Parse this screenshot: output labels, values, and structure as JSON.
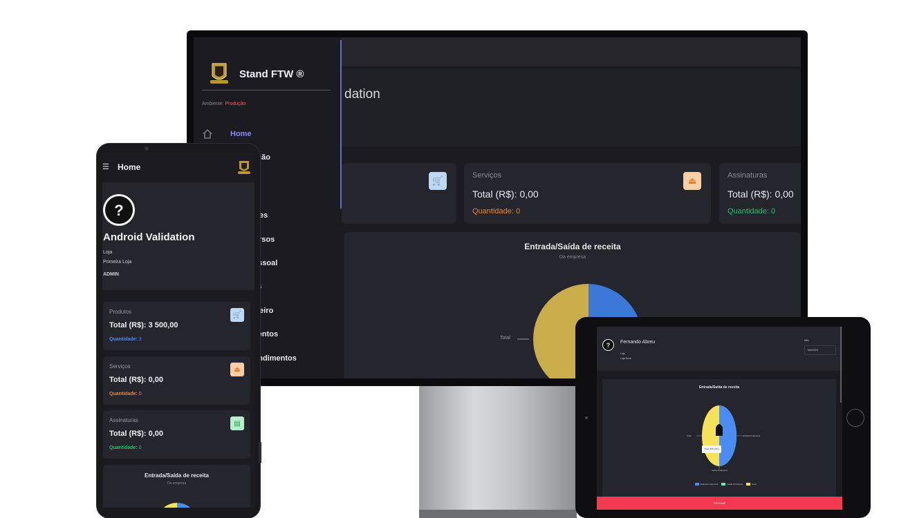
{
  "desktop": {
    "brand": "Stand FTW ®",
    "env_label": "Ambiente:",
    "env_value": "Produção",
    "page_title": "dation",
    "nav": [
      "Home",
      "tração",
      "ações",
      "rsos",
      "essoal",
      "es",
      "ceiro",
      "mentos",
      "eendimentos"
    ],
    "cards": [
      {
        "label": "Serviços",
        "total": "Total (R$): 0,00",
        "qty_label": "Quantidade:",
        "qty": "0"
      },
      {
        "label": "Assinaturas",
        "total": "Total (R$): 0,00",
        "qty_label": "Quantidade:",
        "qty": "0"
      }
    ],
    "chart": {
      "title": "Entrada/Saída de receita",
      "subtitle": "Da empresa",
      "pie_label": "Total"
    }
  },
  "phone": {
    "app_title": "Home",
    "name": "Android Validation",
    "store_label": "Loja",
    "store_value": "Primeira Loja",
    "role": "ADMIN",
    "cards": [
      {
        "label": "Produtos",
        "total": "Total (R$): 3 500,00",
        "qty_label": "Quantidade:",
        "qty": "3"
      },
      {
        "label": "Serviços",
        "total": "Total (R$): 0,00",
        "qty_label": "Quantidade:",
        "qty": "0"
      },
      {
        "label": "Assinaturas",
        "total": "Total (R$): 0,00",
        "qty_label": "Quantidade:",
        "qty": "0"
      }
    ],
    "chart": {
      "title": "Entrada/Saída de receita",
      "subtitle": "Da empresa"
    }
  },
  "tablet": {
    "name": "Fernando Abreu",
    "store_label": "Loja",
    "store_value": "Loja Nova",
    "month_label": "Mês",
    "month_value": "Mar/2024",
    "chart": {
      "title": "Entrada/Saída de receita",
      "labels": [
        "Total",
        "Entrada Financeira",
        "Saída Financeira"
      ],
      "tooltip": "Total: 50% (0%)",
      "legend": [
        "Entrada Financeira",
        "Saída Financeira",
        "Total"
      ]
    },
    "close_label": "FECHAR"
  },
  "colors": {
    "blue": "#4b8cf2",
    "yellow": "#f5e15a",
    "gold": "#c9ad4a",
    "orange": "#e8883a",
    "green": "#27c06b",
    "accent": "#8c86ff",
    "close": "#f2394f"
  },
  "icons": [
    "cart-icon",
    "service-icon",
    "subscription-icon",
    "home-icon",
    "menu-icon",
    "avatar-icon"
  ]
}
